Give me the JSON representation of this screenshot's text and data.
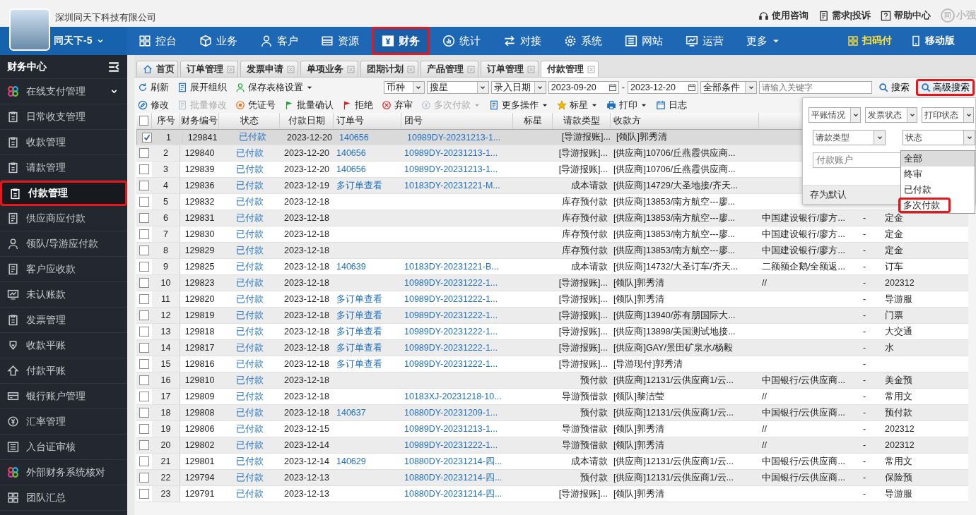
{
  "company": "深圳同天下科技有限公司",
  "top_links": [
    {
      "label": "使用咨询"
    },
    {
      "label": "需求|投诉"
    },
    {
      "label": "帮助中心"
    }
  ],
  "brand": {
    "mark": "同",
    "text": "小强"
  },
  "account": "同天下-5",
  "nav": [
    {
      "label": "控台",
      "selected": false
    },
    {
      "label": "业务",
      "selected": false
    },
    {
      "label": "客户",
      "selected": false
    },
    {
      "label": "资源",
      "selected": false
    },
    {
      "label": "财务",
      "selected": true
    },
    {
      "label": "统计",
      "selected": false
    },
    {
      "label": "对接",
      "selected": false
    },
    {
      "label": "系统",
      "selected": false
    },
    {
      "label": "网站",
      "selected": false
    },
    {
      "label": "运营",
      "selected": false
    },
    {
      "label": "更多",
      "selected": false
    }
  ],
  "nav_right": [
    {
      "label": "扫码付"
    },
    {
      "label": "移动版"
    }
  ],
  "sidebar": {
    "title": "财务中心",
    "items": [
      {
        "label": "在线支付管理",
        "collapsible": true,
        "selected": false
      },
      {
        "label": "日常收支管理",
        "collapsible": false,
        "selected": false
      },
      {
        "label": "收款管理",
        "collapsible": false,
        "selected": false
      },
      {
        "label": "请款管理",
        "collapsible": false,
        "selected": false
      },
      {
        "label": "付款管理",
        "collapsible": false,
        "selected": true
      },
      {
        "label": "供应商应付款",
        "collapsible": false,
        "selected": false
      },
      {
        "label": "领队/导游应付款",
        "collapsible": false,
        "selected": false
      },
      {
        "label": "客户应收款",
        "collapsible": false,
        "selected": false
      },
      {
        "label": "未认账款",
        "collapsible": false,
        "selected": false
      },
      {
        "label": "发票管理",
        "collapsible": false,
        "selected": false
      },
      {
        "label": "收款平账",
        "collapsible": false,
        "selected": false
      },
      {
        "label": "付款平账",
        "collapsible": false,
        "selected": false
      },
      {
        "label": "银行账户管理",
        "collapsible": false,
        "selected": false
      },
      {
        "label": "汇率管理",
        "collapsible": false,
        "selected": false
      },
      {
        "label": "入台证审核",
        "collapsible": false,
        "selected": false
      },
      {
        "label": "外部财务系统核对",
        "collapsible": false,
        "selected": false
      },
      {
        "label": "团队汇总",
        "collapsible": false,
        "selected": false
      }
    ]
  },
  "tabs": [
    {
      "label": "首页",
      "closable": false,
      "selected": false
    },
    {
      "label": "订单管理",
      "closable": true,
      "selected": false
    },
    {
      "label": "发票申请",
      "closable": true,
      "selected": false
    },
    {
      "label": "单项业务",
      "closable": true,
      "selected": false
    },
    {
      "label": "团期计划",
      "closable": true,
      "selected": false
    },
    {
      "label": "产品管理",
      "closable": true,
      "selected": false
    },
    {
      "label": "订单管理",
      "closable": true,
      "selected": false
    },
    {
      "label": "付款管理",
      "closable": true,
      "selected": true
    }
  ],
  "toolbar": {
    "actions": [
      {
        "label": "刷新",
        "menu": false
      },
      {
        "label": "展开组织",
        "menu": false
      },
      {
        "label": "保存表格设置",
        "menu": true
      }
    ],
    "filters": {
      "currency": "币种",
      "star": "搜星",
      "date_type": "录入日期",
      "date_from": "2023-09-20",
      "date_separator": "-",
      "date_to": "2023-12-20",
      "condition": "全部条件",
      "keyword_placeholder": "请输入关键字",
      "search": "搜索",
      "advanced": {
        "label": "高级搜索",
        "highlighted": true
      }
    }
  },
  "actions": [
    {
      "label": "修改",
      "disabled": false,
      "menu": false
    },
    {
      "label": "批量修改",
      "disabled": true,
      "menu": false
    },
    {
      "label": "凭证号",
      "disabled": false,
      "menu": false
    },
    {
      "label": "批量确认",
      "disabled": false,
      "menu": false
    },
    {
      "label": "拒绝",
      "disabled": false,
      "menu": false
    },
    {
      "label": "弃审",
      "disabled": false,
      "menu": false
    },
    {
      "label": "多次付款",
      "disabled": true,
      "menu": true
    },
    {
      "label": "更多操作",
      "disabled": false,
      "menu": true
    },
    {
      "label": "标星",
      "disabled": false,
      "menu": true
    },
    {
      "label": "打印",
      "disabled": false,
      "menu": true
    },
    {
      "label": "日志",
      "disabled": false,
      "menu": false
    }
  ],
  "advanced_panel": {
    "selects": [
      "平账情况",
      "发票状态",
      "打印状态"
    ],
    "request_type": "请款类型",
    "status": {
      "label": "状态",
      "options": [
        {
          "label": "全部",
          "selected": true,
          "highlighted": false
        },
        {
          "label": "终审",
          "selected": false,
          "highlighted": false
        },
        {
          "label": "已付款",
          "selected": false,
          "highlighted": false
        },
        {
          "label": "多次付款",
          "selected": false,
          "highlighted": true
        }
      ]
    },
    "account_placeholder": "付款账户",
    "save_default": "存为默认"
  },
  "table": {
    "header_checked": false,
    "columns": [
      "序号",
      "财务编号",
      "状态",
      "付款日期",
      "订单号",
      "团号",
      "标星",
      "请款类型",
      "收款方"
    ],
    "rows": [
      {
        "checked": true,
        "seq": "1",
        "fin_no": "129841",
        "status": "已付款",
        "date": "2023-12-20",
        "order": "140656",
        "group": "10989DY-20231213-1...",
        "request_type": "[导游报账]...",
        "payee": "[领队]郭秀清"
      },
      {
        "checked": false,
        "seq": "2",
        "fin_no": "129840",
        "status": "已付款",
        "date": "2023-12-20",
        "order": "140656",
        "group": "10989DY-20231213-1...",
        "request_type": "[导游报账]...",
        "payee": "[供应商]10706/丘燕霞供应商..."
      },
      {
        "checked": false,
        "seq": "3",
        "fin_no": "129839",
        "status": "已付款",
        "date": "2023-12-20",
        "order": "140656",
        "group": "10989DY-20231213-1...",
        "request_type": "[导游报账]...",
        "payee": "[供应商]10706/丘燕霞供应商..."
      },
      {
        "checked": false,
        "seq": "4",
        "fin_no": "129836",
        "status": "已付款",
        "date": "2023-12-19",
        "order": "多订单查看",
        "group": "10183DY-20231221-M...",
        "request_type": "成本请款",
        "payee": "[供应商]14729/大圣地接/齐天..."
      },
      {
        "checked": false,
        "seq": "5",
        "fin_no": "129832",
        "status": "已付款",
        "date": "2023-12-18",
        "request_type": "库存预付款",
        "payee": "[供应商]13853/南方航空---廖..."
      },
      {
        "checked": false,
        "seq": "6",
        "fin_no": "129831",
        "status": "已付款",
        "date": "2023-12-18",
        "request_type": "库存预付款",
        "payee": "[供应商]13853/南方航空---廖...",
        "column_11": "中国建设银行/廖方...",
        "column_12": "-",
        "column_13": "定金"
      },
      {
        "checked": false,
        "seq": "7",
        "fin_no": "129830",
        "status": "已付款",
        "date": "2023-12-18",
        "request_type": "库存预付款",
        "payee": "[供应商]13853/南方航空---廖...",
        "column_11": "中国建设银行/廖方...",
        "column_12": "-",
        "column_13": "定金"
      },
      {
        "checked": false,
        "seq": "8",
        "fin_no": "129829",
        "status": "已付款",
        "date": "2023-12-18",
        "request_type": "库存预付款",
        "payee": "[供应商]13853/南方航空---廖...",
        "column_11": "中国建设银行/廖方...",
        "column_12": "-",
        "column_13": "定金"
      },
      {
        "checked": false,
        "seq": "9",
        "fin_no": "129825",
        "status": "已付款",
        "date": "2023-12-18",
        "order": "140639",
        "group": "10183DY-20231221-B...",
        "request_type": "成本请款",
        "payee": "[供应商]14732/大圣订车/齐天...",
        "column_11": "二额额企鹅/全额返...",
        "column_12": "-",
        "column_13": "订车"
      },
      {
        "checked": false,
        "seq": "10",
        "fin_no": "129823",
        "status": "已付款",
        "date": "2023-12-18",
        "group": "10989DY-20231222-1...",
        "request_type": "[导游报账]...",
        "payee": "[领队]郭秀清",
        "column_11": "//",
        "column_12": "-",
        "column_13": "202312"
      },
      {
        "checked": false,
        "seq": "11",
        "fin_no": "129820",
        "status": "已付款",
        "date": "2023-12-18",
        "order": "多订单查看",
        "group": "10989DY-20231222-1...",
        "request_type": "[导游报账]...",
        "payee": "[领队]郭秀清",
        "column_12": "-",
        "column_13": "导游服"
      },
      {
        "checked": false,
        "seq": "12",
        "fin_no": "129819",
        "status": "已付款",
        "date": "2023-12-18",
        "order": "多订单查看",
        "group": "10989DY-20231222-1...",
        "request_type": "[导游报账]...",
        "payee": "[供应商]13940/苏有朋国际大...",
        "column_12": "-",
        "column_13": "门票"
      },
      {
        "checked": false,
        "seq": "13",
        "fin_no": "129818",
        "status": "已付款",
        "date": "2023-12-18",
        "order": "多订单查看",
        "group": "10989DY-20231222-1...",
        "request_type": "[导游报账]...",
        "payee": "[供应商]13898/美国测试地接...",
        "column_12": "-",
        "column_13": "大交通"
      },
      {
        "checked": false,
        "seq": "14",
        "fin_no": "129817",
        "status": "已付款",
        "date": "2023-12-18",
        "order": "多订单查看",
        "group": "10989DY-20231222-1...",
        "request_type": "[导游报账]...",
        "payee": "[供应商]GAY/景田矿泉水/杨毅",
        "column_12": "-",
        "column_13": "水"
      },
      {
        "checked": false,
        "seq": "15",
        "fin_no": "129816",
        "status": "已付款",
        "date": "2023-12-18",
        "order": "多订单查看",
        "group": "10989DY-20231222-1...",
        "request_type": "[导游报账]...",
        "payee": "[导游现付]郭秀清",
        "column_12": "-"
      },
      {
        "checked": false,
        "seq": "16",
        "fin_no": "129810",
        "status": "已付款",
        "date": "2023-12-18",
        "request_type": "预付款",
        "payee": "[供应商]12131/云供应商1/云...",
        "column_11": "中国银行/云供应商...",
        "column_12": "-",
        "column_13": "美金预"
      },
      {
        "checked": false,
        "seq": "17",
        "fin_no": "129809",
        "status": "已付款",
        "date": "2023-12-18",
        "group": "10183XJ-20231218-10...",
        "request_type": "导游预借款",
        "payee": "[领队]黎洁莹",
        "column_11": "//",
        "column_12": "-",
        "column_13": "常用文"
      },
      {
        "checked": false,
        "seq": "18",
        "fin_no": "129808",
        "status": "已付款",
        "date": "2023-12-18",
        "order": "140637",
        "group": "10880DY-20231209-1...",
        "request_type": "预付款",
        "payee": "[供应商]12131/云供应商1/云...",
        "column_11": "中国银行/云供应商...",
        "column_12": "-",
        "column_13": "预付款"
      },
      {
        "checked": false,
        "seq": "19",
        "fin_no": "129806",
        "status": "已付款",
        "date": "2023-12-15",
        "group": "10989DY-20231213-1...",
        "request_type": "导游预借款",
        "payee": "[领队]郭秀清",
        "column_11": "//",
        "column_12": "-",
        "column_13": "202312"
      },
      {
        "checked": false,
        "seq": "20",
        "fin_no": "129802",
        "status": "已付款",
        "date": "2023-12-14",
        "group": "10989DY-20231222-1...",
        "request_type": "导游预借款",
        "payee": "[领队]郭秀清",
        "column_11": "//",
        "column_12": "-",
        "column_13": "202312"
      },
      {
        "checked": false,
        "seq": "21",
        "fin_no": "129801",
        "status": "已付款",
        "date": "2023-12-14",
        "order": "140629",
        "group": "10880DY-20231214-四...",
        "request_type": "成本请款",
        "payee": "[供应商]12131/云供应商1/云...",
        "column_11": "中国银行/云供应商...",
        "column_12": "-",
        "column_13": "常用文"
      },
      {
        "checked": false,
        "seq": "22",
        "fin_no": "129794",
        "status": "已付款",
        "date": "2023-12-13",
        "group": "10880DY-20231214-四...",
        "request_type": "预付款",
        "payee": "[供应商]12131/云供应商1/云...",
        "column_11": "中国银行/云供应商...",
        "column_12": "-",
        "column_13": "保险预"
      },
      {
        "checked": false,
        "seq": "23",
        "fin_no": "129791",
        "status": "已付款",
        "date": "2023-12-13",
        "group": "10880DY-20231214-四...",
        "request_type": "[导游报账]...",
        "payee": "[领队]郭秀清",
        "column_12": "-",
        "column_13": "导游服"
      }
    ]
  }
}
